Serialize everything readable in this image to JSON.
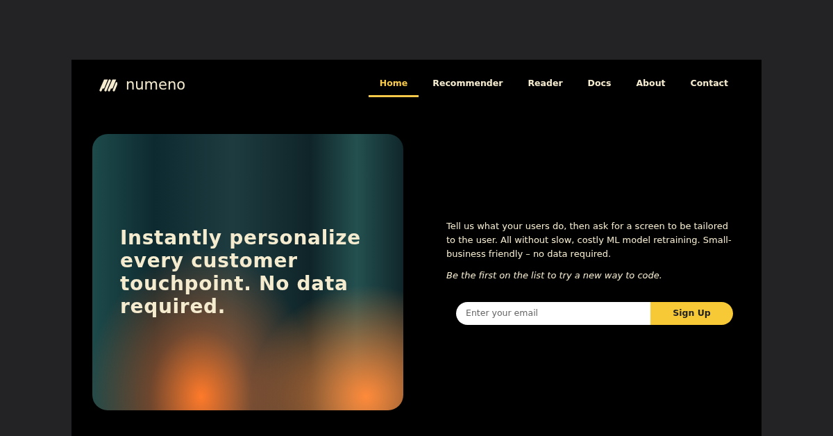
{
  "brand": {
    "name": "numeno"
  },
  "nav": [
    {
      "label": "Home",
      "selected": true
    },
    {
      "label": "Recommender",
      "selected": false
    },
    {
      "label": "Reader",
      "selected": false
    },
    {
      "label": "Docs",
      "selected": false
    },
    {
      "label": "About",
      "selected": false
    },
    {
      "label": "Contact",
      "selected": false
    }
  ],
  "hero": {
    "headline": "Instantly personalize every customer touchpoint. No data required.",
    "description": "Tell us what your users do, then ask for a screen to be tailored to the user.  All without slow, costly ML model retraining.  Small-business friendly – no data required.",
    "tagline": "Be the first on the list to try a new way to code.",
    "email": {
      "placeholder": "Enter your email"
    },
    "button": "Sign Up"
  }
}
